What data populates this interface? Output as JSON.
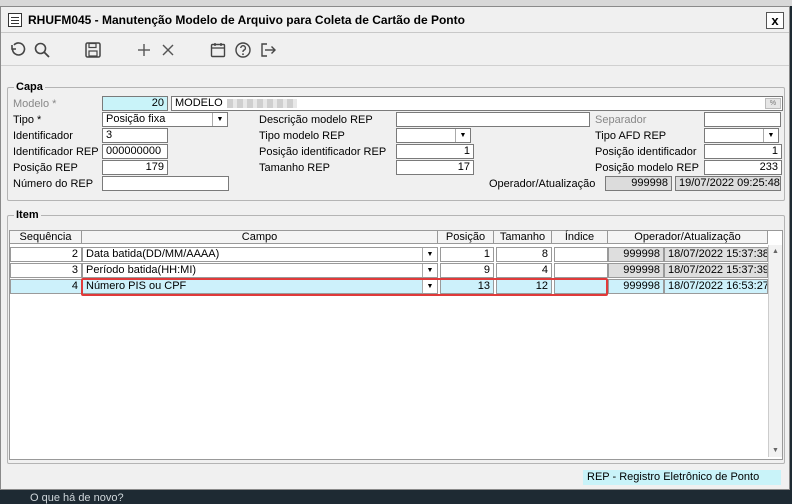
{
  "window": {
    "title": "RHUFM045 - Manutenção Modelo de Arquivo para Coleta de Cartão de Ponto",
    "close_label": "x"
  },
  "toolbar": [
    "undo-icon",
    "search-icon",
    "save-icon",
    "add-icon",
    "delete-icon",
    "calendar-icon",
    "help-icon",
    "exit-icon"
  ],
  "capa": {
    "legend": "Capa",
    "modelo_label": "Modelo *",
    "modelo_value": "20",
    "modelo_desc": "MODELO",
    "tipo_label": "Tipo *",
    "tipo_value": "Posição fixa",
    "identificador_label": "Identificador",
    "identificador_value": "3",
    "identificador_rep_label": "Identificador REP",
    "identificador_rep_value": "000000000",
    "posicao_rep_label": "Posição REP",
    "posicao_rep_value": "179",
    "numero_rep_label": "Número do REP",
    "numero_rep_value": "",
    "descricao_modelo_label": "Descrição modelo REP",
    "descricao_modelo_value": "",
    "tipo_modelo_label": "Tipo modelo REP",
    "tipo_modelo_value": "",
    "pos_identificador_rep_label": "Posição identificador REP",
    "pos_identificador_rep_value": "1",
    "tamanho_rep_label": "Tamanho REP",
    "tamanho_rep_value": "17",
    "separador_label": "Separador",
    "separador_value": "",
    "tipo_afd_label": "Tipo AFD REP",
    "tipo_afd_value": "",
    "pos_identificador_label": "Posição identificador",
    "pos_identificador_value": "1",
    "pos_modelo_label": "Posição modelo REP",
    "pos_modelo_value": "233",
    "operador_label": "Operador/Atualização",
    "operador_value": "999998",
    "atualizacao_value": "19/07/2022 09:25:48"
  },
  "item": {
    "legend": "Item",
    "headers": [
      "Sequência",
      "Campo",
      "Posição",
      "Tamanho",
      "Índice",
      "Operador/Atualização"
    ],
    "rows": [
      {
        "seq": "2",
        "campo": "Data batida(DD/MM/AAAA)",
        "posicao": "1",
        "tamanho": "8",
        "indice": "",
        "operador": "999998",
        "data": "18/07/2022 15:37:38"
      },
      {
        "seq": "3",
        "campo": "Período batida(HH:MI)",
        "posicao": "9",
        "tamanho": "4",
        "indice": "",
        "operador": "999998",
        "data": "18/07/2022 15:37:39"
      },
      {
        "seq": "4",
        "campo": "Número PIS ou CPF",
        "posicao": "13",
        "tamanho": "12",
        "indice": "",
        "operador": "999998",
        "data": "18/07/2022 16:53:27"
      }
    ]
  },
  "status": {
    "text": "REP - Registro Eletrônico de Ponto"
  },
  "background_text": "O que há de novo?"
}
